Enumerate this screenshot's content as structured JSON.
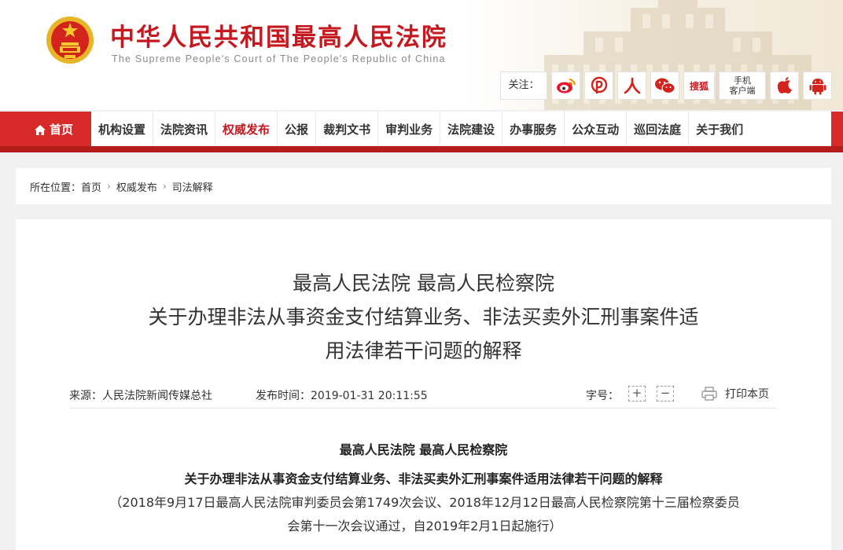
{
  "header": {
    "title": "中华人民共和国最高人民法院",
    "subtitle": "The Supreme People's Court of The People's Republic of China",
    "follow_label": "关注：",
    "social_icons": [
      "weibo-icon",
      "people-daily-icon",
      "people-icon",
      "wechat-icon",
      "sohu-icon",
      "mobile-client-icon",
      "apple-icon",
      "android-icon"
    ],
    "sohu_label": "搜狐",
    "mobile_label_1": "手机",
    "mobile_label_2": "客户端"
  },
  "nav": {
    "items": [
      {
        "label": "首页"
      },
      {
        "label": "机构设置"
      },
      {
        "label": "法院资讯"
      },
      {
        "label": "权威发布"
      },
      {
        "label": "公报"
      },
      {
        "label": "裁判文书"
      },
      {
        "label": "审判业务"
      },
      {
        "label": "法院建设"
      },
      {
        "label": "办事服务"
      },
      {
        "label": "公众互动"
      },
      {
        "label": "巡回法庭"
      },
      {
        "label": "关于我们"
      }
    ],
    "active_index": 3
  },
  "breadcrumb": {
    "prefix": "所在位置：",
    "items": [
      "首页",
      "权威发布",
      "司法解释"
    ]
  },
  "article": {
    "title_lines": [
      "最高人民法院 最高人民检察院",
      "关于办理非法从事资金支付结算业务、非法买卖外汇刑事案件适",
      "用法律若干问题的解释"
    ],
    "source": "来源：人民法院新闻传媒总社",
    "publish_time": "发布时间：2019-01-31 20:11:55",
    "font_size_label": "字号：",
    "font_plus": "+",
    "font_minus": "−",
    "print_label": "打印本页",
    "body_heading_1": "最高人民法院 最高人民检察院",
    "body_heading_2": "关于办理非法从事资金支付结算业务、非法买卖外汇刑事案件适用法律若干问题的解释",
    "body_note_1": "（2018年9月17日最高人民法院审判委员会第1749次会议、2018年12月12日最高人民检察院第十三届检察委员",
    "body_note_2": "会第十一次会议通过，自2019年2月1日起施行）"
  },
  "colors": {
    "brand_red": "#c5181f",
    "nav_red": "#d92a2a",
    "background": "#f1f1f1"
  }
}
